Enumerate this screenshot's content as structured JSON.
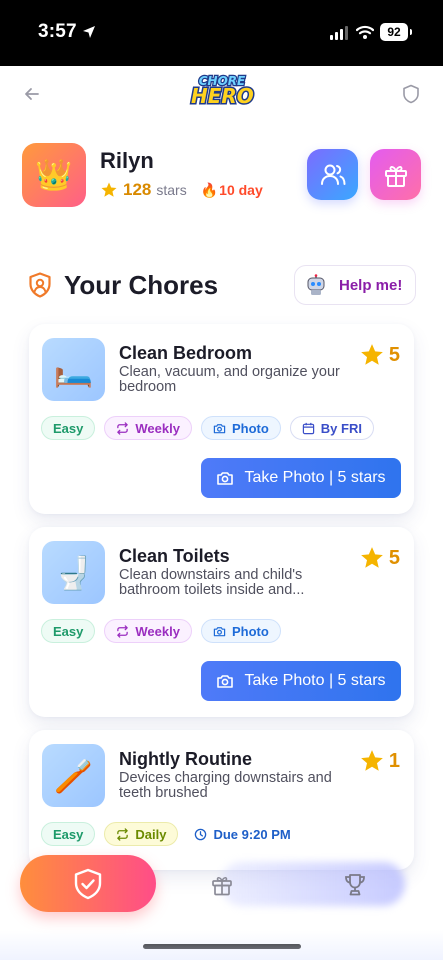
{
  "status_bar": {
    "time": "3:57",
    "battery": "92"
  },
  "header": {
    "logo_line1": "CHORE",
    "logo_line2": "HERO"
  },
  "profile": {
    "avatar_emoji": "👑",
    "name": "Rilyn",
    "stars": "128",
    "stars_label": "stars",
    "streak_emoji": "🔥",
    "streak": "10 day"
  },
  "section": {
    "title": "Your Chores",
    "help_label": "Help me!"
  },
  "chores": [
    {
      "icon": "🛏️",
      "title": "Clean Bedroom",
      "description": "Clean, vacuum, and organize your bedroom",
      "points": "5",
      "tags": [
        "Easy",
        "Weekly",
        "Photo",
        "By FRI"
      ],
      "action_label": "Take Photo | 5 stars"
    },
    {
      "icon": "🚽",
      "title": "Clean Toilets",
      "description": "Clean downstairs and child's bathroom toilets inside and...",
      "points": "5",
      "tags": [
        "Easy",
        "Weekly",
        "Photo"
      ],
      "action_label": "Take Photo | 5 stars"
    },
    {
      "icon": "🪥",
      "title": "Nightly Routine",
      "description": "Devices charging downstairs and teeth brushed",
      "points": "1",
      "tags": [
        "Easy",
        "Daily",
        "Due 9:20 PM"
      ]
    }
  ],
  "colors": {
    "accent_orange": "#ff8e3c",
    "accent_pink": "#ff4d88",
    "primary_blue": "#2f74ee",
    "star_gold": "#f5b400"
  },
  "icons": [
    "back-arrow-icon",
    "shield-icon",
    "star-icon",
    "family-icon",
    "gift-icon",
    "shield-user-icon",
    "robot-icon",
    "repeat-icon",
    "camera-icon",
    "calendar-icon",
    "clock-icon",
    "shield-check-icon",
    "trophy-icon"
  ]
}
